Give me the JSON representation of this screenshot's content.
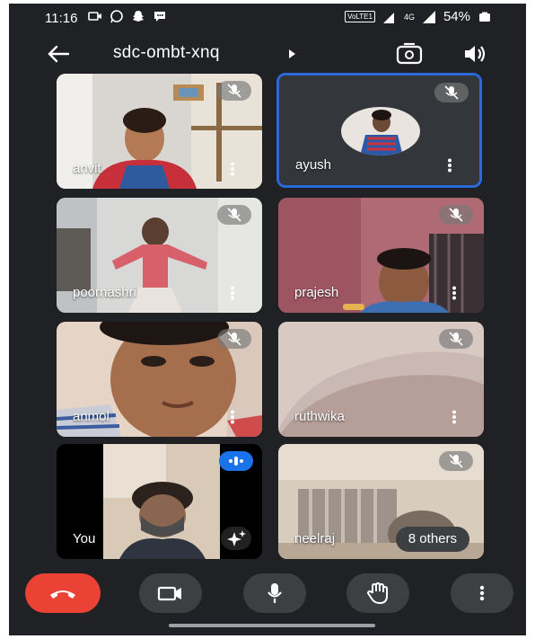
{
  "status_bar": {
    "time": "11:16",
    "network_badge": "VoLTE1",
    "network_type": "4G",
    "battery_level": "54%",
    "icons": [
      "video-call-icon",
      "whatsapp-icon",
      "snapchat-icon",
      "chat-icon",
      "signal-icon",
      "battery-icon"
    ]
  },
  "header": {
    "meeting_code": "sdc-ombt-xnq",
    "icons": [
      "back-arrow-icon",
      "dropdown-arrow-icon",
      "switch-camera-icon",
      "speaker-icon"
    ]
  },
  "participants": [
    {
      "name": "anvit",
      "muted": true
    },
    {
      "name": "ayush",
      "muted": true,
      "active_speaker": true
    },
    {
      "name": "poornashri",
      "muted": true
    },
    {
      "name": "prajesh",
      "muted": true
    },
    {
      "name": "anmol",
      "muted": true
    },
    {
      "name": "ruthwika",
      "muted": true
    },
    {
      "name": "You",
      "speaking": true
    },
    {
      "name": "neelraj",
      "muted": true,
      "others_label": "8 others"
    }
  ],
  "call_controls": [
    "end-call-icon",
    "camera-icon",
    "microphone-icon",
    "raise-hand-icon",
    "more-options-icon"
  ],
  "colors": {
    "background": "#202124",
    "hangup": "#ea4335",
    "control": "#3c4043",
    "active_border": "#2b68d9",
    "speaking_badge": "#1a73e8"
  }
}
